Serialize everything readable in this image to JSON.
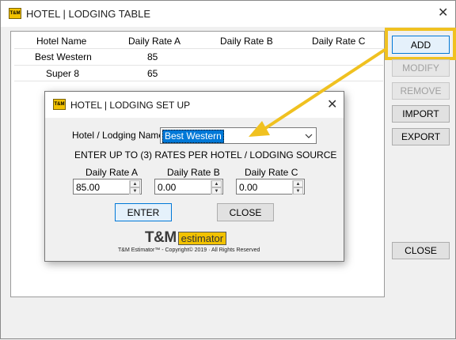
{
  "window": {
    "title": "HOTEL | LODGING TABLE",
    "icon_text": "T&M"
  },
  "table": {
    "columns": [
      "Hotel Name",
      "Daily Rate A",
      "Daily Rate B",
      "Daily Rate C"
    ],
    "rows": [
      {
        "name": "Best Western",
        "rate_a": "85",
        "rate_b": "",
        "rate_c": ""
      },
      {
        "name": "Super 8",
        "rate_a": "65",
        "rate_b": "",
        "rate_c": ""
      }
    ]
  },
  "buttons": {
    "add": "ADD",
    "modify": "MODIFY",
    "remove": "REMOVE",
    "import": "IMPORT",
    "export": "EXPORT",
    "close": "CLOSE"
  },
  "dialog": {
    "title": "HOTEL | LODGING SET UP",
    "icon_text": "T&M",
    "hotel_label": "Hotel / Lodging Name",
    "hotel_value": "Best Western",
    "instructions": "ENTER UP TO (3) RATES PER HOTEL /  LODGING SOURCE",
    "rate_a_label": "Daily Rate A",
    "rate_b_label": "Daily Rate B",
    "rate_c_label": "Daily Rate C",
    "rate_a_value": "85.00",
    "rate_b_value": "0.00",
    "rate_c_value": "0.00",
    "enter_label": "ENTER",
    "close_label": "CLOSE",
    "logo_tm": "T&M",
    "logo_est": "estimator",
    "copyright": "T&M Estimator™ - Copyright© 2019 · All Rights Reserved"
  },
  "colors": {
    "highlight": "#f0c120",
    "selection": "#0078d7"
  }
}
